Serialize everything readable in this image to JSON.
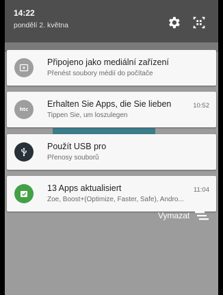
{
  "status_bar": {
    "time": "14:22",
    "date": "pondělí 2. května",
    "icons": [
      "gear-icon",
      "quick-settings-icon"
    ]
  },
  "notifications": [
    {
      "icon": "usb-media-icon",
      "icon_color": "#9e9e9e",
      "title": "Připojeno jako mediální zařízení",
      "subtitle": "Přenést soubory médií do počítače",
      "time": ""
    },
    {
      "icon": "htc-icon",
      "icon_color": "#9e9e9e",
      "title": "Erhalten Sie Apps, die Sie lieben",
      "subtitle": "Tippen Sie, um loszulegen",
      "time": "10:52"
    },
    {
      "icon": "usb-icon",
      "icon_color": "#263238",
      "title": "Použít USB pro",
      "subtitle": "Přenosy souborů",
      "time": ""
    },
    {
      "icon": "play-store-update-icon",
      "icon_color": "#43a047",
      "title": "13 Apps aktualisiert",
      "subtitle": "Zoe, Boost+(Optimize, Faster, Safe), Andro...",
      "time": "11:04"
    }
  ],
  "clear_all": {
    "label": "Vymazat",
    "icon": "clear-all-icon"
  }
}
